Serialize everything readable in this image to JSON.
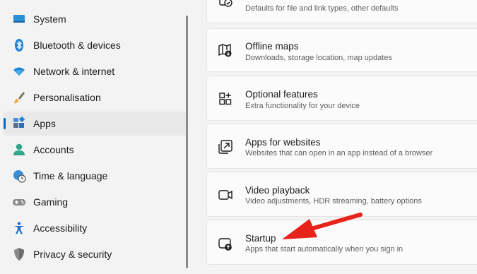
{
  "sidebar": {
    "items": [
      {
        "label": "System",
        "icon": "system-icon"
      },
      {
        "label": "Bluetooth & devices",
        "icon": "bluetooth-icon"
      },
      {
        "label": "Network & internet",
        "icon": "wifi-icon"
      },
      {
        "label": "Personalisation",
        "icon": "brush-icon"
      },
      {
        "label": "Apps",
        "icon": "apps-icon",
        "selected": true
      },
      {
        "label": "Accounts",
        "icon": "person-icon"
      },
      {
        "label": "Time & language",
        "icon": "globe-clock-icon"
      },
      {
        "label": "Gaming",
        "icon": "gamepad-icon"
      },
      {
        "label": "Accessibility",
        "icon": "accessibility-icon"
      },
      {
        "label": "Privacy & security",
        "icon": "shield-icon"
      }
    ]
  },
  "main": {
    "cards": [
      {
        "title": "",
        "subtitle": "Defaults for file and link types, other defaults",
        "icon": "default-apps-icon"
      },
      {
        "title": "Offline maps",
        "subtitle": "Downloads, storage location, map updates",
        "icon": "map-icon"
      },
      {
        "title": "Optional features",
        "subtitle": "Extra functionality for your device",
        "icon": "optional-features-icon"
      },
      {
        "title": "Apps for websites",
        "subtitle": "Websites that can open in an app instead of a browser",
        "icon": "open-in-app-icon"
      },
      {
        "title": "Video playback",
        "subtitle": "Video adjustments, HDR streaming, battery options",
        "icon": "video-icon"
      },
      {
        "title": "Startup",
        "subtitle": "Apps that start automatically when you sign in",
        "icon": "startup-icon"
      }
    ]
  },
  "colors": {
    "accent": "#0067c0",
    "arrow": "#e8231c"
  }
}
